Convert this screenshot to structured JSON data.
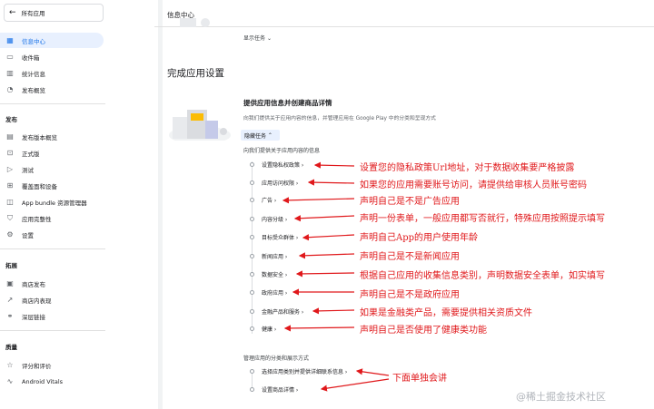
{
  "sidebar": {
    "back_label": "所有应用",
    "items": [
      {
        "label": "信息中心",
        "icon": "dashboard-icon",
        "active": true
      },
      {
        "label": "收件箱",
        "icon": "inbox-icon"
      },
      {
        "label": "统计信息",
        "icon": "bar-chart-icon"
      },
      {
        "label": "发布概览",
        "icon": "publish-overview-icon"
      }
    ],
    "section_release": "发布",
    "release_items": [
      {
        "label": "发布版本概览",
        "icon": "release-overview-icon"
      },
      {
        "label": "正式版",
        "icon": "production-icon"
      },
      {
        "label": "测试",
        "icon": "testing-icon"
      },
      {
        "label": "覆盖面和设备",
        "icon": "devices-icon"
      },
      {
        "label": "App bundle 资源管理器",
        "icon": "bundle-icon"
      },
      {
        "label": "应用完整性",
        "icon": "shield-icon"
      },
      {
        "label": "设置",
        "icon": "gear-icon"
      }
    ],
    "section_growth": "拓展",
    "growth_items": [
      {
        "label": "商店发布",
        "icon": "store-icon"
      },
      {
        "label": "商店内表现",
        "icon": "trend-icon"
      },
      {
        "label": "深层链接",
        "icon": "link-icon"
      }
    ],
    "section_quality": "质量",
    "quality_items": [
      {
        "label": "评分和评价",
        "icon": "rating-icon"
      },
      {
        "label": "Android Vitals",
        "icon": "vitals-icon"
      }
    ]
  },
  "header": {
    "title": "信息中心"
  },
  "show_tasks": "显示任务",
  "section_title": "完成应用设置",
  "card": {
    "title": "提供应用信息并创建商品详情",
    "desc": "向我们提供关于应用内容的信息，并管理应用在 Google Play 中的分类和呈现方式",
    "hide_tasks": "隐藏任务",
    "subhead": "向我们提供关于应用内容的信息",
    "tasks": [
      "设置隐私权政策 ›",
      "应用访问权限 ›",
      "广告 ›",
      "内容分级 ›",
      "目标受众群体 ›",
      "新闻应用 ›",
      "数据安全 ›",
      "政府应用 ›",
      "金融产品和服务 ›",
      "健康 ›"
    ],
    "subhead2": "管理应用的分类和展示方式",
    "tasks2": [
      "选择应用类别并提供详细联系信息 ›",
      "设置商品详情 ›"
    ]
  },
  "annotations": [
    "设置您的隐私政策Url地址，对于数据收集要严格披露",
    "如果您的应用需要账号访问，请提供给审核人员账号密码",
    "声明自己是不是广告应用",
    "声明一份表单，一般应用都写否就行，特殊应用按照提示填写",
    "声明自己App的用户使用年龄",
    "声明自己是不是新闻应用",
    "根据自己应用的收集信息类别，声明数据安全表单，如实填写",
    "声明自己是不是政府应用",
    "如果是金融类产品，需要提供相关资质文件",
    "声明自己是否使用了健康类功能",
    "下面单独会讲"
  ],
  "watermark": "@稀土掘金技术社区",
  "colors": {
    "accent": "#1a73e8",
    "annotation": "#e0181b"
  }
}
